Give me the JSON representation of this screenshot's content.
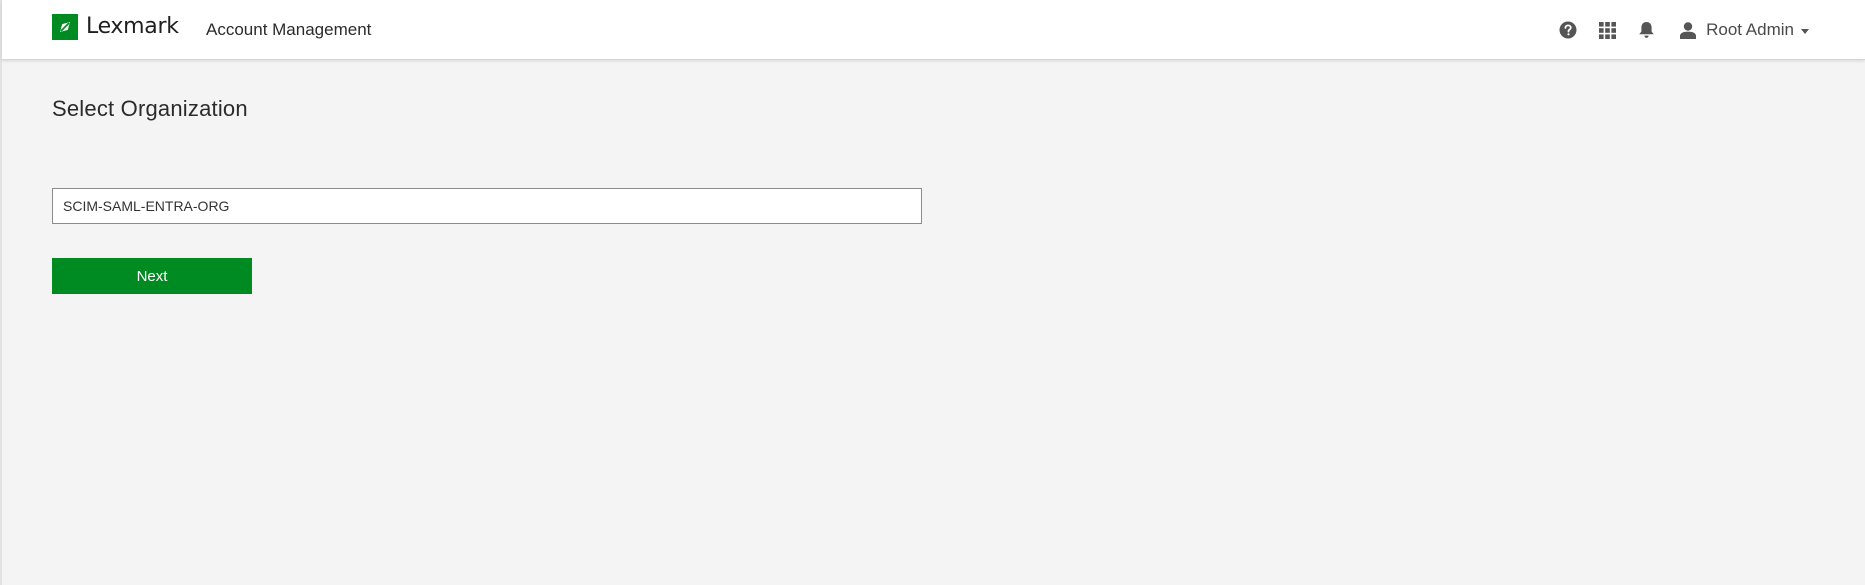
{
  "header": {
    "brand_name": "Lexmark",
    "app_title": "Account Management",
    "user_name": "Root Admin",
    "icons": [
      "help-circle-icon",
      "app-grid-icon",
      "bell-icon",
      "user-icon",
      "caret-down-icon"
    ]
  },
  "main": {
    "title": "Select Organization",
    "org_input": {
      "value": "SCIM-SAML-ENTRA-ORG",
      "placeholder": ""
    },
    "next_label": "Next"
  },
  "colors": {
    "brand_green": "#008a22",
    "header_bg": "#ffffff",
    "page_bg": "#f4f4f4",
    "icon_gray": "#555555"
  }
}
